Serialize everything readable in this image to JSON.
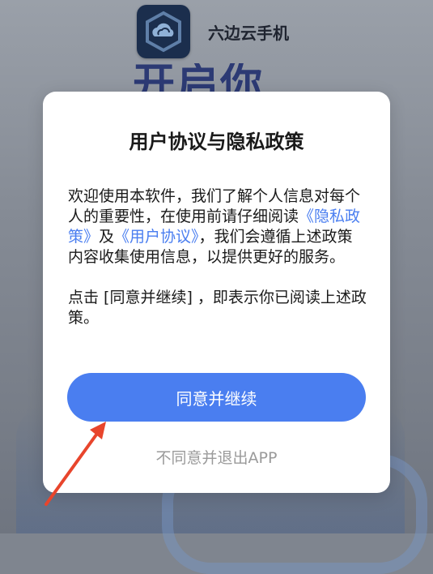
{
  "app": {
    "name": "六边云手机",
    "icon": "cloud-hexagon-icon",
    "headline_partial": "开启你的"
  },
  "dialog": {
    "title": "用户协议与隐私政策",
    "body": {
      "p1_part1": "欢迎使用本软件，我们了解个人信息对每个人的重要性，在使用前请仔细阅读",
      "privacy_link": "《隐私政策》",
      "and": "及",
      "user_agreement_link": "《用户协议》",
      "p1_part2": "，我们会遵循上述政策内容收集使用信息，以提供更好的服务。",
      "p2": "点击 [同意并继续] ，即表示你已阅读上述政策。"
    },
    "agree_label": "同意并继续",
    "decline_label": "不同意并退出APP"
  },
  "colors": {
    "accent": "#4a7ef0",
    "annotation_arrow": "#e8452c"
  }
}
